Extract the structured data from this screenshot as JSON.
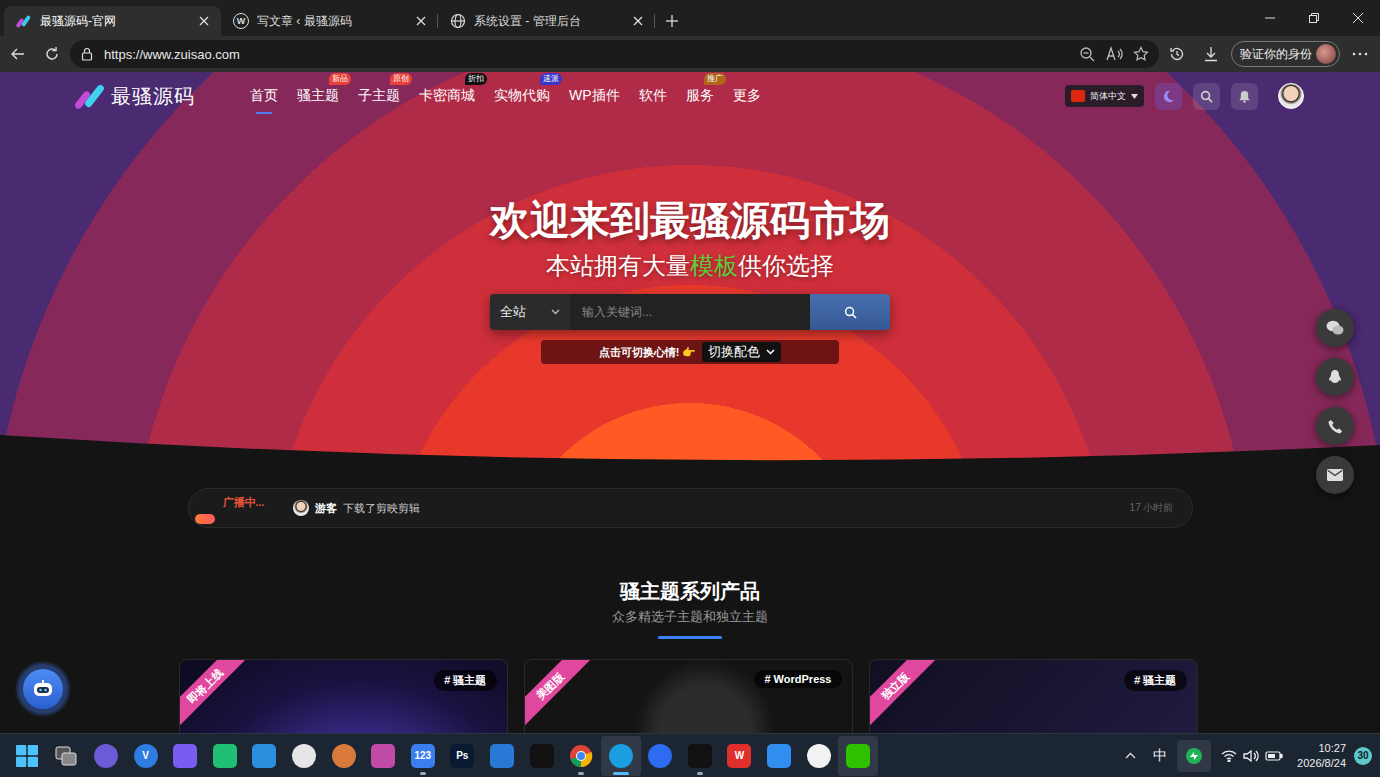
{
  "browser": {
    "tabs": [
      {
        "title": "最骚源码-官网",
        "kind": "site",
        "selected": true
      },
      {
        "title": "写文章 ‹ 最骚源码",
        "kind": "wordpress",
        "icon_text": "W",
        "selected": false
      },
      {
        "title": "系统设置 - 管理后台",
        "kind": "globe",
        "selected": false
      }
    ],
    "url": "https://www.zuisao.com",
    "profile": "验证你的身份"
  },
  "site": {
    "logo": "最骚源码",
    "nav": [
      {
        "label": "首页",
        "selected": true
      },
      {
        "label": "骚主题",
        "badge": "新品",
        "color": "#e8413a",
        "selected": false
      },
      {
        "label": "子主题",
        "badge": "原创",
        "color": "#e8413a",
        "selected": false
      },
      {
        "label": "卡密商城",
        "badge": "折扣",
        "color": "#111111",
        "selected": false
      },
      {
        "label": "实物代购",
        "badge": "速派",
        "color": "#3a36c8",
        "selected": false
      },
      {
        "label": "WP插件",
        "selected": false
      },
      {
        "label": "软件",
        "selected": false
      },
      {
        "label": "服务",
        "badge": "推广",
        "color": "#b0651c",
        "selected": false
      },
      {
        "label": "更多",
        "selected": false
      }
    ],
    "language": "简体中文",
    "hero": {
      "title": "欢迎来到最骚源码市场",
      "subtitle_before": "本站拥有大量",
      "subtitle_highlight": "模板",
      "subtitle_after": "供你选择"
    },
    "search": {
      "scope": "全站",
      "placeholder": "输入关键词..."
    },
    "mood": {
      "prompt": "点击可切换心情! 👉",
      "select": "切换配色"
    },
    "broadcast": {
      "label": "广播中...",
      "user": "游客",
      "message": "下载了剪映剪辑",
      "time": "17 小时前"
    },
    "section": {
      "title": "骚主题系列产品",
      "subtitle": "众多精选子主题和独立主题"
    },
    "cards": [
      {
        "ribbon": "即将上线",
        "tag": "# 骚主题"
      },
      {
        "ribbon": "美图版",
        "tag": "# WordPress"
      },
      {
        "ribbon": "独立版",
        "tag": "# 骚主题"
      }
    ]
  },
  "taskbar": {
    "apps": [
      {
        "kind": "windows",
        "color": "#4cc2ff",
        "running": false,
        "selected": false,
        "highlighted": false
      },
      {
        "kind": "taskview",
        "color": "#dddddd",
        "running": false,
        "selected": false,
        "highlighted": false
      },
      {
        "kind": "round",
        "color": "#6b5bd6",
        "running": false,
        "selected": false,
        "highlighted": false
      },
      {
        "kind": "round",
        "color": "#2f7de1",
        "label": "V",
        "running": false,
        "selected": false,
        "highlighted": false
      },
      {
        "kind": "tile",
        "color": "#7b5cf0",
        "running": false,
        "selected": false,
        "highlighted": false
      },
      {
        "kind": "tile",
        "color": "#1fbf75",
        "running": false,
        "selected": false,
        "highlighted": false
      },
      {
        "kind": "tile",
        "color": "#2b8fe0",
        "running": false,
        "selected": false,
        "highlighted": false
      },
      {
        "kind": "round",
        "color": "#e6e6e6",
        "running": false,
        "selected": false,
        "highlighted": false
      },
      {
        "kind": "round",
        "color": "#d97a3c",
        "running": false,
        "selected": false,
        "highlighted": false
      },
      {
        "kind": "tile",
        "color": "#c04aa8",
        "running": false,
        "selected": false,
        "highlighted": false
      },
      {
        "kind": "tile",
        "color": "#3a7ef0",
        "label": "123",
        "running": true,
        "selected": false,
        "highlighted": false
      },
      {
        "kind": "tile",
        "color": "#0a1a33",
        "label": "Ps",
        "running": false,
        "selected": false,
        "highlighted": false
      },
      {
        "kind": "tile",
        "color": "#2a78d6",
        "running": false,
        "selected": false,
        "highlighted": false
      },
      {
        "kind": "tile",
        "color": "#111111",
        "running": false,
        "selected": false,
        "highlighted": false
      },
      {
        "kind": "chrome",
        "color": "#4285f4",
        "running": true,
        "selected": false,
        "highlighted": false
      },
      {
        "kind": "round",
        "color": "#1b9de2",
        "running": true,
        "selected": true,
        "highlighted": true
      },
      {
        "kind": "round",
        "color": "#2d6cf0",
        "running": false,
        "selected": false,
        "highlighted": false
      },
      {
        "kind": "tile",
        "color": "#111111",
        "running": true,
        "selected": false,
        "highlighted": false
      },
      {
        "kind": "tile",
        "color": "#e0302c",
        "label": "W",
        "running": false,
        "selected": false,
        "highlighted": false
      },
      {
        "kind": "tile",
        "color": "#2f8ef0",
        "running": false,
        "selected": false,
        "highlighted": false
      },
      {
        "kind": "round",
        "color": "#f2f2f2",
        "running": false,
        "selected": false,
        "highlighted": false
      },
      {
        "kind": "tile",
        "color": "#2dc100",
        "running": false,
        "selected": false,
        "highlighted": true
      }
    ],
    "ime": "中",
    "time": "10:27",
    "date": "2026/8/24",
    "notifications": "30"
  }
}
